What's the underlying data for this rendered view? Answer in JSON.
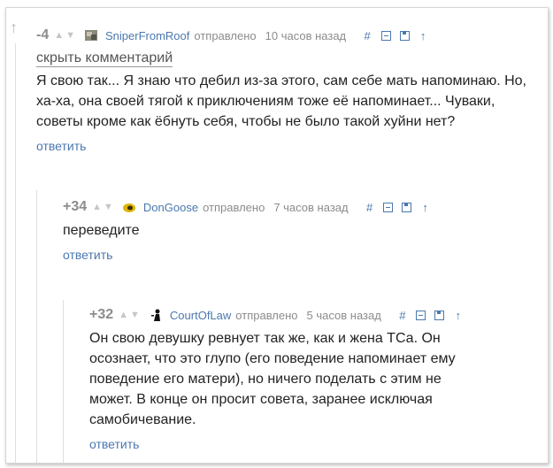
{
  "comments": [
    {
      "rating": "-4",
      "username": "SniperFromRoof",
      "sent_label": "отправлено",
      "time": "10 часов назад",
      "hide_label": "скрыть комментарий",
      "body": "Я свою так... Я знаю что дебил из-за этого, сам себе мать напоминаю. Но, ха-ха, она своей тягой к приключениям тоже её напоминает... Чуваки, советы кроме как ёбнуть себя, чтобы не было такой хуйни нет?",
      "reply_label": "ответить"
    },
    {
      "rating": "+34",
      "username": "DonGoose",
      "sent_label": "отправлено",
      "time": "7 часов назад",
      "body": "переведите",
      "reply_label": "ответить"
    },
    {
      "rating": "+32",
      "username": "CourtOfLaw",
      "sent_label": "отправлено",
      "time": "5 часов назад",
      "body": "Он свою девушку ревнует так же, как и жена ТСа. Он осознает, что это глупо (его поведение напоминает ему поведение его матери), но ничего поделать с этим не может. В конце он просит совета, заранее исключая самобичевание.",
      "reply_label": "ответить"
    }
  ],
  "icons": {
    "thread_arrow": "arrow-up-icon",
    "vote_up": "triangle-up-icon",
    "vote_down": "triangle-down-icon",
    "link": "hash-icon",
    "collapse": "minus-box-icon",
    "save": "save-icon",
    "parent": "arrow-up-icon"
  },
  "colors": {
    "link_blue": "#4b78b0",
    "meta_gray": "#8c8c8c",
    "text": "#222222"
  }
}
